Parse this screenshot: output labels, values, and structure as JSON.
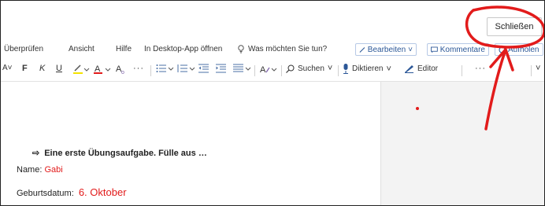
{
  "topbar": {
    "close_label": "Schließen"
  },
  "menubar": {
    "items": [
      "Überprüfen",
      "Ansicht",
      "Hilfe",
      "In Desktop-App öffnen"
    ],
    "search_placeholder": "Was möchten Sie tun?",
    "edit_label": "Bearbeiten",
    "comments_label": "Kommentare",
    "catchup_label": "Aufholen"
  },
  "toolbar": {
    "font_size_label": "A˅",
    "bold": "F",
    "italic": "K",
    "underline": "U",
    "search_label": "Suchen",
    "dictate_label": "Diktieren",
    "editor_label": "Editor",
    "more": "···"
  },
  "document": {
    "task_arrow": "⇨",
    "task_text": "Eine erste Übungsaufgabe. Fülle aus …",
    "name_label": "Name:",
    "name_value": "Gabi",
    "birthdate_label": "Geburtsdatum:",
    "birthdate_value": "6. Oktober"
  },
  "colors": {
    "annotation_red": "#e21b1b",
    "accent_blue": "#2b5797"
  }
}
